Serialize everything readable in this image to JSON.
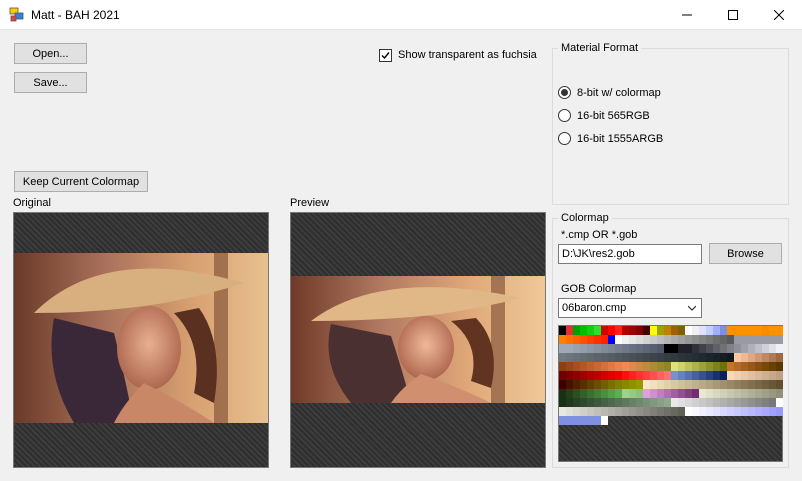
{
  "window": {
    "title": "Matt - BAH 2021"
  },
  "buttons": {
    "open": "Open...",
    "save": "Save...",
    "keep_colormap": "Keep Current Colormap",
    "browse": "Browse"
  },
  "options": {
    "show_transparent_label": "Show transparent as fuchsia",
    "show_transparent_checked": true
  },
  "labels": {
    "original": "Original",
    "preview": "Preview"
  },
  "material_format": {
    "title": "Material Format",
    "options": [
      {
        "label": "8-bit w/ colormap",
        "checked": true
      },
      {
        "label": "16-bit 565RGB",
        "checked": false
      },
      {
        "label": "16-bit 1555ARGB",
        "checked": false
      }
    ]
  },
  "colormap": {
    "title": "Colormap",
    "file_hint": "*.cmp OR *.gob",
    "path_value": "D:\\JK\\res2.gob",
    "gob_label": "GOB Colormap",
    "gob_selected": "06baron.cmp"
  },
  "palette_rows": [
    [
      "#000000",
      "#e03030",
      "#00a000",
      "#00c000",
      "#10d010",
      "#30e030",
      "#d00000",
      "#ff0000",
      "#ff2020",
      "#b00000",
      "#a00000",
      "#800000",
      "#400000",
      "#ffff00",
      "#a0a000",
      "#c08000",
      "#a06000",
      "#806000",
      "#ffffff",
      "#f0f0f0",
      "#e0e0ff",
      "#c0d0ff",
      "#a0b0ff",
      "#8090e0",
      "#ff9000",
      "#ff9000",
      "#ff9000",
      "#ff9000",
      "#ff9000",
      "#ff8800",
      "#ff9000",
      "#ff9000"
    ],
    [
      "#ff8000",
      "#ff7000",
      "#ff6000",
      "#ff5000",
      "#ff4000",
      "#ff3000",
      "#ff2000",
      "#0000ff",
      "#ffffff",
      "#f0f0f0",
      "#e6e6e6",
      "#dcdcdc",
      "#d2d2d2",
      "#c8c8c8",
      "#bebebe",
      "#b4b4b4",
      "#aaaaaa",
      "#a0a0a0",
      "#969696",
      "#8c8c8c",
      "#828282",
      "#787878",
      "#6e6e6e",
      "#646464",
      "#5a5a5a",
      "#9a9aa4",
      "#9a9aa4",
      "#9a9aa4",
      "#9a9aa4",
      "#9a9aa4",
      "#9a9aa4",
      "#9a9aa4"
    ],
    [
      "#a0a8b8",
      "#a0a8b8",
      "#9aa2b2",
      "#949cac",
      "#8e96a6",
      "#8890a0",
      "#828a9a",
      "#7c8494",
      "#767e8e",
      "#707888",
      "#6a7282",
      "#646c7c",
      "#5e6676",
      "#586070",
      "#525a6a",
      "#000000",
      "#000000",
      "#202028",
      "#202028",
      "#303038",
      "#404048",
      "#505058",
      "#606068",
      "#707078",
      "#808088",
      "#909098",
      "#a0a0a8",
      "#b0b0b8",
      "#c0c0c8",
      "#d0d0d8",
      "#e0e0e8",
      "#f0f0f8"
    ],
    [
      "#707880",
      "#6c747c",
      "#687078",
      "#646c74",
      "#606870",
      "#5c646c",
      "#586068",
      "#545c64",
      "#505860",
      "#4c545c",
      "#485058",
      "#444c54",
      "#404850",
      "#3c444c",
      "#384048",
      "#343c44",
      "#303840",
      "#2c343c",
      "#283038",
      "#242c34",
      "#202830",
      "#1c242c",
      "#182028",
      "#141c24",
      "#101820",
      "#ffc8a0",
      "#f0b890",
      "#e0a880",
      "#d09870",
      "#c08860",
      "#b07850",
      "#a06840"
    ],
    [
      "#8c4010",
      "#984818",
      "#a45020",
      "#b05828",
      "#bc6030",
      "#c86838",
      "#d47040",
      "#e07848",
      "#ec8050",
      "#f08858",
      "#e08850",
      "#d08848",
      "#c08840",
      "#b08838",
      "#a08830",
      "#908828",
      "#e0e080",
      "#d0d070",
      "#c0c060",
      "#b0b050",
      "#a0a040",
      "#909030",
      "#808020",
      "#707010",
      "#c87030",
      "#b86828",
      "#a86020",
      "#985818",
      "#885010",
      "#784808",
      "#684000",
      "#583800"
    ],
    [
      "#700000",
      "#800000",
      "#900000",
      "#a00000",
      "#b00000",
      "#c00000",
      "#d00000",
      "#e00000",
      "#f00000",
      "#ff1010",
      "#ff2020",
      "#ff3030",
      "#ff4040",
      "#ff5050",
      "#ff6060",
      "#ff7070",
      "#7890d0",
      "#6880c0",
      "#5870b0",
      "#4860a0",
      "#385090",
      "#284080",
      "#183070",
      "#082060",
      "#f8d8b8",
      "#f0d0b0",
      "#e8c8a8",
      "#e0c0a0",
      "#d8b898",
      "#d0b090",
      "#c8a888",
      "#c0a080"
    ],
    [
      "#400000",
      "#481000",
      "#502000",
      "#583000",
      "#604000",
      "#685000",
      "#706000",
      "#787000",
      "#808000",
      "#888800",
      "#909000",
      "#989800",
      "#f8e8c8",
      "#f0e0c0",
      "#e8d8b8",
      "#e0d0b0",
      "#d8c8a8",
      "#d0c0a0",
      "#c8b898",
      "#c0b090",
      "#b8a888",
      "#b0a080",
      "#a89878",
      "#a09070",
      "#988868",
      "#908060",
      "#887858",
      "#807050",
      "#786848",
      "#706040",
      "#685838",
      "#605030"
    ],
    [
      "#1a3010",
      "#224018",
      "#2a5020",
      "#326028",
      "#3a7030",
      "#428038",
      "#4a9040",
      "#52a048",
      "#5ab050",
      "#a0d090",
      "#98c888",
      "#90c080",
      "#e0a0e0",
      "#d090d0",
      "#c080c0",
      "#b070b0",
      "#a060a0",
      "#905090",
      "#804080",
      "#703070",
      "#e8e8d0",
      "#e0e0c8",
      "#d8d8c0",
      "#d0d0b8",
      "#c8c8b0",
      "#c0c0a8",
      "#b8b8a0",
      "#b0b098",
      "#a8a890",
      "#a0a088",
      "#989880",
      "#909078"
    ],
    [
      "#183018",
      "#203820",
      "#284028",
      "#304830",
      "#385038",
      "#405840",
      "#486048",
      "#506850",
      "#587058",
      "#607860",
      "#688068",
      "#708870",
      "#789078",
      "#809880",
      "#88a088",
      "#90a890",
      "#e8e8e8",
      "#e0e0e0",
      "#d8d8d8",
      "#d0d0d0",
      "#c8c8c8",
      "#c0c0c0",
      "#b8b8b8",
      "#b0b0b0",
      "#a8a8a8",
      "#a0a0a0",
      "#989898",
      "#909090",
      "#888888",
      "#808080",
      "#787878",
      "#ffffff"
    ],
    [
      "#e8e8e0",
      "#e0e0d8",
      "#d8d8d0",
      "#d0d0c8",
      "#c8c8c0",
      "#c0c0b8",
      "#b8b8b0",
      "#b0b0a8",
      "#a8a8a0",
      "#a0a098",
      "#989890",
      "#909088",
      "#888880",
      "#808078",
      "#787870",
      "#707068",
      "#686860",
      "#606058",
      "#ffffff",
      "#f8f8ff",
      "#f0f0ff",
      "#e8e8ff",
      "#e0e0ff",
      "#d8d8ff",
      "#d0d0ff",
      "#c8c8ff",
      "#c0c0ff",
      "#b8b8ff",
      "#b0b0ff",
      "#a8a8ff",
      "#a0a0ff",
      "#9898ff"
    ],
    [
      "#8090e0",
      "#8090e0",
      "#8090e0",
      "#8090e0",
      "#8090e0",
      "#8090e0",
      "#ffffff"
    ]
  ]
}
